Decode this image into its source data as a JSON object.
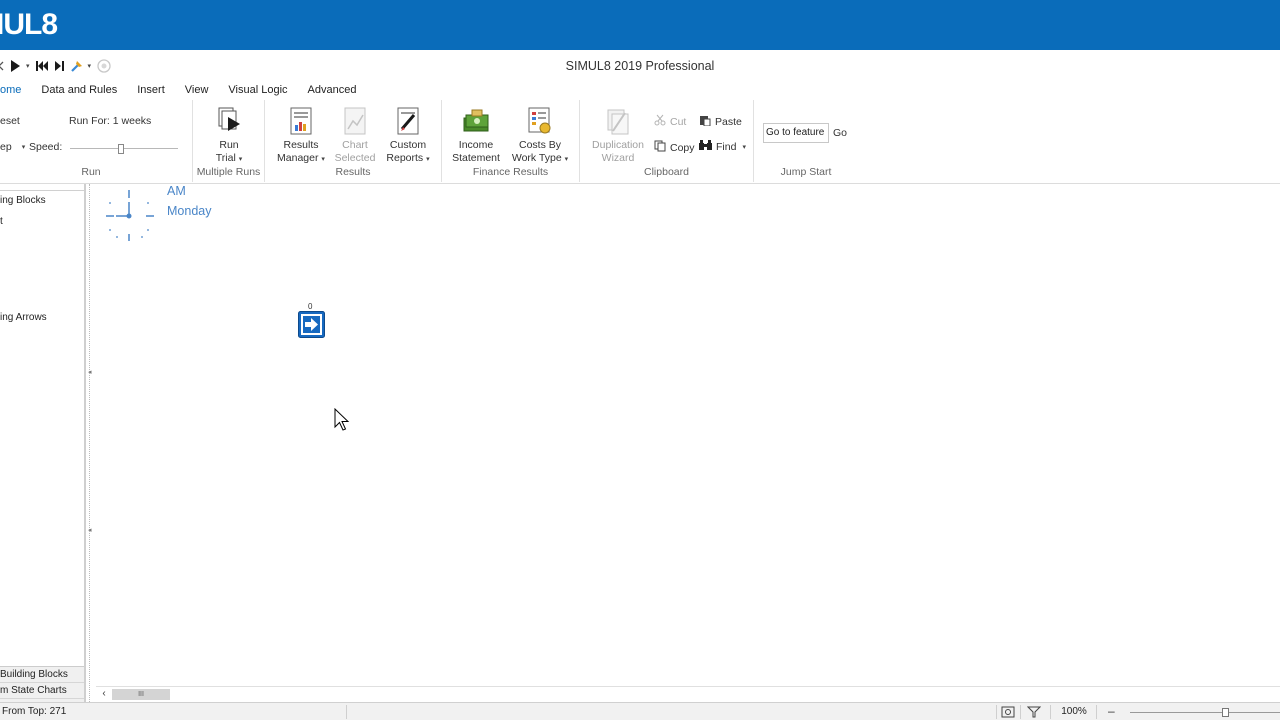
{
  "app": {
    "logo_text": "IUL8",
    "window_title": "SIMUL8 2019 Professional",
    "brand_color": "#0a6cba"
  },
  "quick_access": {
    "icons": [
      "back-icon",
      "play-icon",
      "rewind-icon",
      "step-icon",
      "tools-icon",
      "disabled-circle-icon"
    ]
  },
  "tabs": [
    {
      "label": "ome",
      "active": true
    },
    {
      "label": "Data and Rules"
    },
    {
      "label": "Insert"
    },
    {
      "label": "View"
    },
    {
      "label": "Visual Logic"
    },
    {
      "label": "Advanced"
    }
  ],
  "ribbon": {
    "run_group": {
      "reset_label": "eset",
      "step_label": "ep",
      "run_for_label": "Run For: 1 weeks",
      "speed_label": "Speed:",
      "group_label": "Run"
    },
    "multiple_runs": {
      "run_trial_line1": "Run",
      "run_trial_line2": "Trial",
      "group_label": "Multiple Runs"
    },
    "results": {
      "results_manager_line1": "Results",
      "results_manager_line2": "Manager",
      "chart_selected_line1": "Chart",
      "chart_selected_line2": "Selected",
      "custom_reports_line1": "Custom",
      "custom_reports_line2": "Reports",
      "group_label": "Results"
    },
    "finance": {
      "income_line1": "Income",
      "income_line2": "Statement",
      "costs_line1": "Costs By",
      "costs_line2": "Work Type",
      "group_label": "Finance Results"
    },
    "clipboard": {
      "duplication_line1": "Duplication",
      "duplication_line2": "Wizard",
      "cut_label": "Cut",
      "copy_label": "Copy",
      "paste_label": "Paste",
      "find_label": "Find",
      "group_label": "Clipboard"
    },
    "jump_start": {
      "go_to_feature_value": "Go to feature ...",
      "go_label": "Go",
      "group_label": "Jump Start"
    }
  },
  "left_panel": {
    "items": [
      "ing Blocks",
      "t",
      "ing Arrows"
    ],
    "bottom_tabs": [
      "Building Blocks",
      "m State Charts"
    ]
  },
  "canvas": {
    "clock_ampm": "AM",
    "clock_day": "Monday",
    "entry_count": "0"
  },
  "status": {
    "text": "From Top: 271",
    "zoom": "100%",
    "zoom_minus": "–"
  }
}
